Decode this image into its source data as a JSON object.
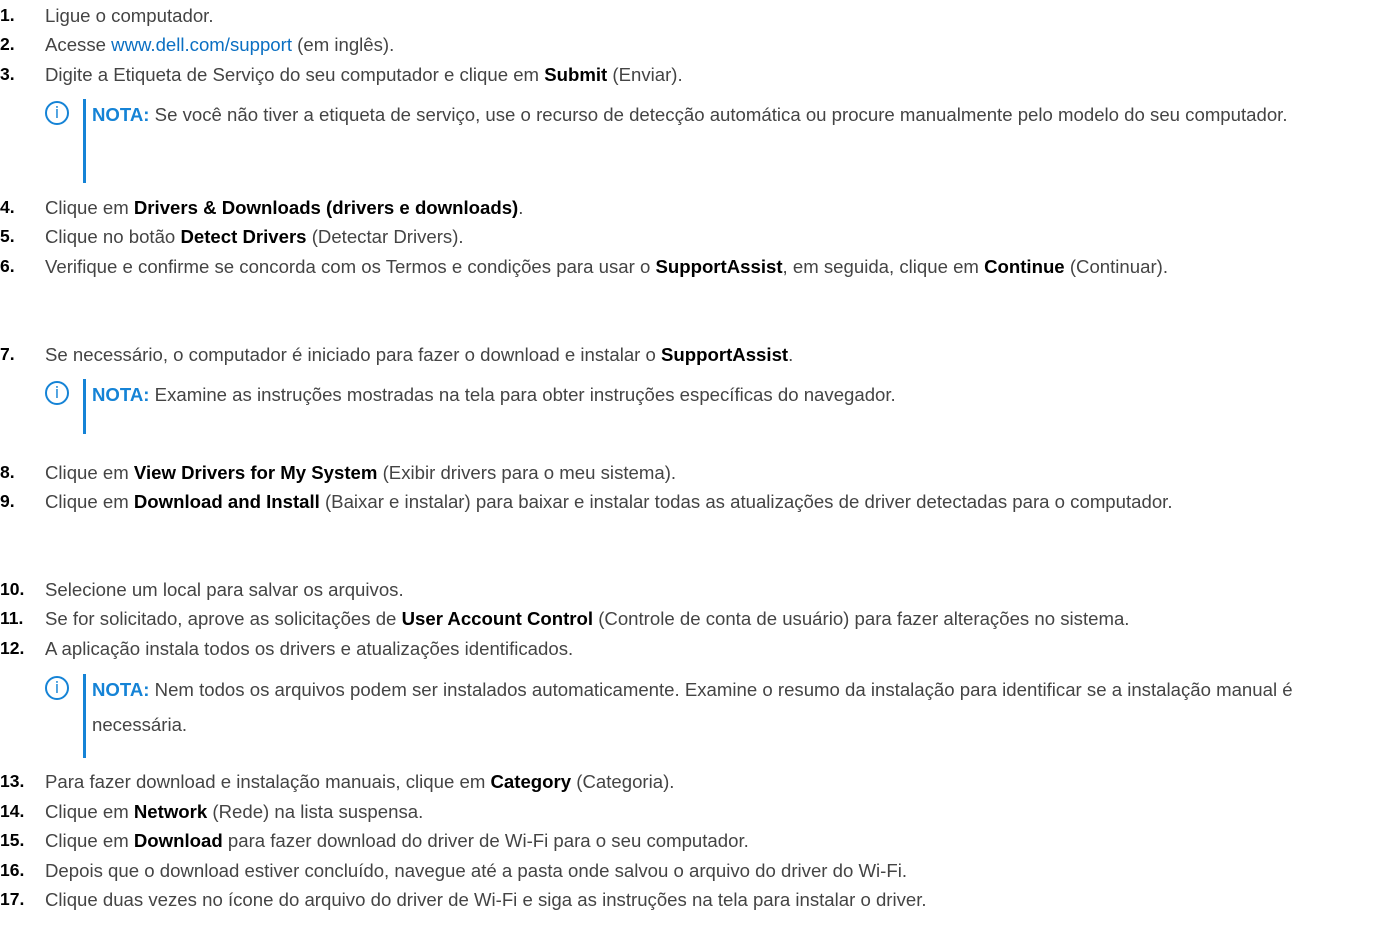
{
  "steps": [
    {
      "n": "1.",
      "parts": [
        {
          "t": "Ligue o computador."
        }
      ]
    },
    {
      "n": "2.",
      "parts": [
        {
          "t": "Acesse "
        },
        {
          "t": "www.dell.com/support",
          "link": true
        },
        {
          "t": " (em inglês)."
        }
      ]
    },
    {
      "n": "3.",
      "parts": [
        {
          "t": "Digite a Etiqueta de Serviço do seu computador e clique em "
        },
        {
          "t": "Submit",
          "b": true
        },
        {
          "t": " (Enviar)."
        }
      ]
    },
    {
      "n": "4.",
      "parts": [
        {
          "t": "Clique em "
        },
        {
          "t": "Drivers & Downloads (drivers e downloads)",
          "b": true
        },
        {
          "t": "."
        }
      ]
    },
    {
      "n": "5.",
      "parts": [
        {
          "t": "Clique no botão "
        },
        {
          "t": "Detect Drivers",
          "b": true
        },
        {
          "t": " (Detectar Drivers)."
        }
      ]
    },
    {
      "n": "6.",
      "parts": [
        {
          "t": "Verifique e confirme se concorda com os Termos e condições para usar o "
        },
        {
          "t": "SupportAssist",
          "b": true
        },
        {
          "t": ", em seguida, clique em "
        },
        {
          "t": "Continue",
          "b": true
        },
        {
          "t": " (Continuar)."
        }
      ]
    },
    {
      "n": "7.",
      "parts": [
        {
          "t": "Se necessário, o computador é iniciado para fazer o download e instalar o "
        },
        {
          "t": "SupportAssist",
          "b": true
        },
        {
          "t": "."
        }
      ]
    },
    {
      "n": "8.",
      "parts": [
        {
          "t": "Clique em "
        },
        {
          "t": "View Drivers for My System",
          "b": true
        },
        {
          "t": " (Exibir drivers para o meu sistema)."
        }
      ]
    },
    {
      "n": "9.",
      "parts": [
        {
          "t": "Clique em "
        },
        {
          "t": "Download and Install",
          "b": true
        },
        {
          "t": " (Baixar e instalar) para baixar e instalar todas as atualizações de driver detectadas para o computador."
        }
      ]
    },
    {
      "n": "10.",
      "parts": [
        {
          "t": "Selecione um local para salvar os arquivos."
        }
      ]
    },
    {
      "n": "11.",
      "parts": [
        {
          "t": "Se for solicitado, aprove as solicitações de "
        },
        {
          "t": "User Account Control",
          "b": true
        },
        {
          "t": " (Controle de conta de usuário) para fazer alterações no sistema."
        }
      ]
    },
    {
      "n": "12.",
      "parts": [
        {
          "t": "A aplicação instala todos os drivers e atualizações identificados."
        }
      ]
    },
    {
      "n": "13.",
      "parts": [
        {
          "t": "Para fazer download e instalação manuais, clique em "
        },
        {
          "t": "Category",
          "b": true
        },
        {
          "t": " (Categoria)."
        }
      ]
    },
    {
      "n": "14.",
      "parts": [
        {
          "t": "Clique em "
        },
        {
          "t": "Network",
          "b": true
        },
        {
          "t": " (Rede) na lista suspensa."
        }
      ]
    },
    {
      "n": "15.",
      "parts": [
        {
          "t": "Clique em "
        },
        {
          "t": "Download",
          "b": true
        },
        {
          "t": " para fazer download do driver de Wi-Fi para o seu computador."
        }
      ]
    },
    {
      "n": "16.",
      "parts": [
        {
          "t": "Depois que o download estiver concluído, navegue até a pasta onde salvou o arquivo do driver do Wi-Fi."
        }
      ]
    },
    {
      "n": "17.",
      "parts": [
        {
          "t": "Clique duas vezes no ícone do arquivo do driver de Wi-Fi e siga as instruções na tela para instalar o driver."
        }
      ]
    }
  ],
  "notes": [
    {
      "icon": "info-icon",
      "label": "NOTA:",
      "text": " Se você não tiver a etiqueta de serviço, use o recurso de detecção automática ou procure manualmente pelo modelo do seu computador."
    },
    {
      "icon": "info-icon",
      "label": "NOTA:",
      "text": " Examine as instruções mostradas na tela para obter instruções específicas do navegador."
    },
    {
      "icon": "info-icon",
      "label": "NOTA:",
      "text": " Nem todos os arquivos podem ser instalados automaticamente. Examine o resumo da instalação para identificar se a instalação manual é necessária."
    }
  ],
  "colors": {
    "text": "#444444",
    "number": "#000000",
    "link": "#0a6fc2",
    "note_accent": "#1583d6"
  }
}
